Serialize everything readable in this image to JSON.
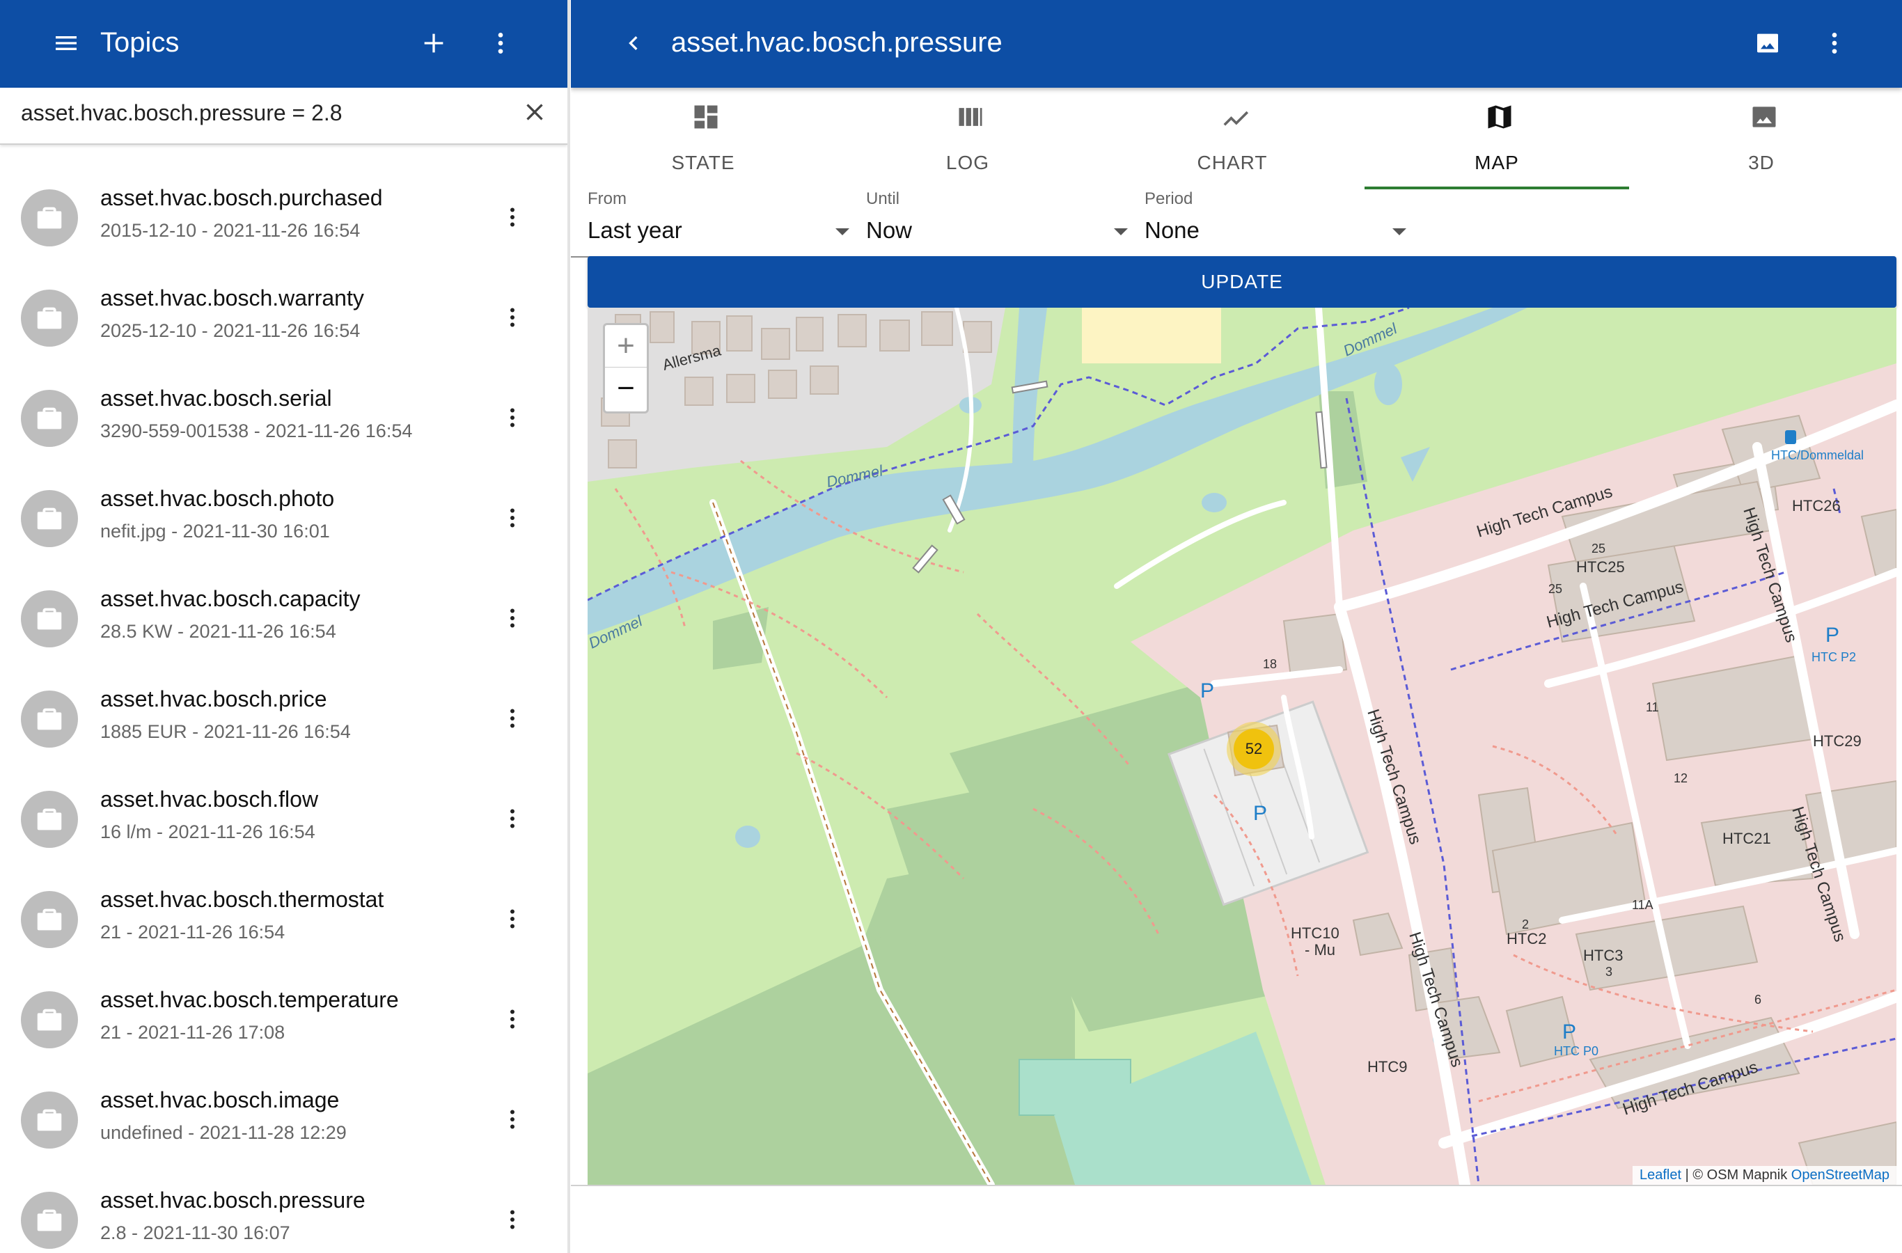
{
  "left": {
    "title": "Topics",
    "search_value": "asset.hvac.bosch.pressure = 2.8",
    "items": [
      {
        "name": "asset.hvac.bosch.purchased",
        "detail": "2015-12-10 - 2021-11-26 16:54"
      },
      {
        "name": "asset.hvac.bosch.warranty",
        "detail": "2025-12-10 - 2021-11-26 16:54"
      },
      {
        "name": "asset.hvac.bosch.serial",
        "detail": "3290-559-001538 - 2021-11-26 16:54"
      },
      {
        "name": "asset.hvac.bosch.photo",
        "detail": "nefit.jpg - 2021-11-30 16:01"
      },
      {
        "name": "asset.hvac.bosch.capacity",
        "detail": "28.5 KW - 2021-11-26 16:54"
      },
      {
        "name": "asset.hvac.bosch.price",
        "detail": "1885 EUR - 2021-11-26 16:54"
      },
      {
        "name": "asset.hvac.bosch.flow",
        "detail": "16 l/m - 2021-11-26 16:54"
      },
      {
        "name": "asset.hvac.bosch.thermostat",
        "detail": "21 - 2021-11-26 16:54"
      },
      {
        "name": "asset.hvac.bosch.temperature",
        "detail": "21 - 2021-11-26 17:08"
      },
      {
        "name": "asset.hvac.bosch.image",
        "detail": "undefined - 2021-11-28 12:29"
      },
      {
        "name": "asset.hvac.bosch.pressure",
        "detail": "2.8 - 2021-11-30 16:07"
      }
    ]
  },
  "right": {
    "title": "asset.hvac.bosch.pressure",
    "tabs": [
      {
        "label": "STATE",
        "icon": "dashboard-icon"
      },
      {
        "label": "LOG",
        "icon": "columns-icon"
      },
      {
        "label": "CHART",
        "icon": "chart-line-icon"
      },
      {
        "label": "MAP",
        "icon": "map-icon",
        "active": true
      },
      {
        "label": "3D",
        "icon": "image-icon"
      }
    ],
    "filters": {
      "from": {
        "label": "From",
        "value": "Last year"
      },
      "until": {
        "label": "Until",
        "value": "Now"
      },
      "period": {
        "label": "Period",
        "value": "None"
      }
    },
    "update_label": "UPDATE",
    "map": {
      "zoom_in": "+",
      "zoom_out": "−",
      "cluster_count": "52",
      "attribution": {
        "leaflet": "Leaflet",
        "sep": " | © OSM Mapnik ",
        "osm": "OpenStreetMap"
      },
      "labels": {
        "allersma": "Allersma",
        "dommel": "Dommel",
        "htc_dommeldal": "HTC/Dommeldal",
        "high_tech_campus": "High Tech Campus",
        "htc25": "HTC25",
        "htc26": "HTC26",
        "htc29": "HTC29",
        "htc21": "HTC21",
        "htc2": "HTC2",
        "htc3": "HTC3",
        "htc9": "HTC9",
        "htc10": "HTC10",
        "mu": "- Mu",
        "htc_p2": "HTC P2",
        "htc_p0": "HTC P0",
        "n11": "11",
        "n11a": "11A",
        "n12": "12",
        "n18": "18",
        "n25": "25",
        "n6": "6",
        "n3": "3",
        "n2": "2",
        "p": "P"
      }
    }
  }
}
